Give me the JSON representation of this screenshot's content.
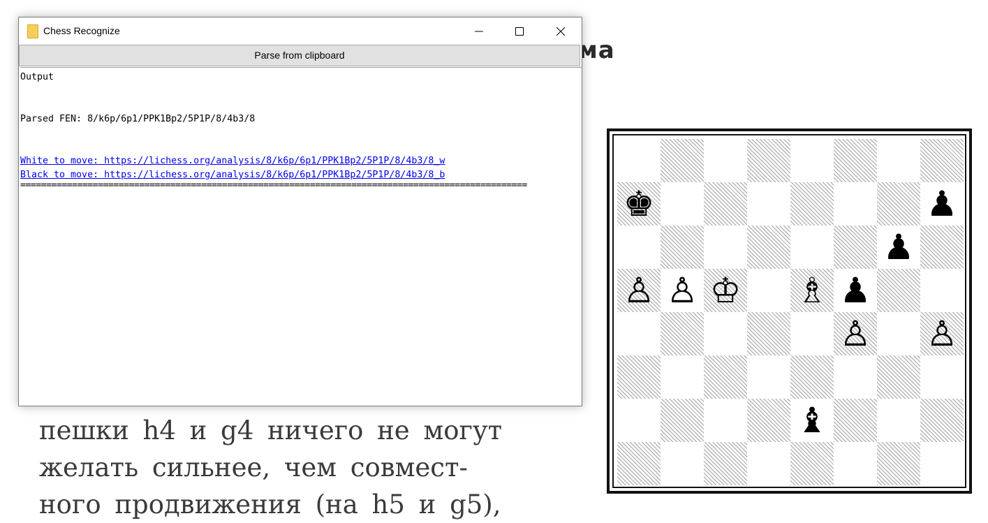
{
  "background": {
    "heading_fragment": "ма",
    "book_lines": [
      "пешки h4 и g4 ничего не могут",
      "желать сильнее, чем совмест-",
      "ного продвижения (на h5 и g5),"
    ]
  },
  "diagram": {
    "pieces": [
      {
        "square": "a7",
        "glyph": "♚",
        "name": "black-king"
      },
      {
        "square": "h7",
        "glyph": "♟",
        "name": "black-pawn"
      },
      {
        "square": "g6",
        "glyph": "♟",
        "name": "black-pawn"
      },
      {
        "square": "a5",
        "glyph": "♙",
        "name": "white-pawn"
      },
      {
        "square": "b5",
        "glyph": "♙",
        "name": "white-pawn"
      },
      {
        "square": "c5",
        "glyph": "♔",
        "name": "white-king"
      },
      {
        "square": "e5",
        "glyph": "♗",
        "name": "white-bishop"
      },
      {
        "square": "f5",
        "glyph": "♟",
        "name": "black-pawn"
      },
      {
        "square": "f4",
        "glyph": "♙",
        "name": "white-pawn"
      },
      {
        "square": "h4",
        "glyph": "♙",
        "name": "white-pawn"
      },
      {
        "square": "e2",
        "glyph": "♝",
        "name": "black-bishop"
      }
    ]
  },
  "window": {
    "title": "Chess Recognize",
    "app_icon": "folder-icon",
    "controls": {
      "minimize": "minimize-icon",
      "maximize": "maximize-icon",
      "close": "close-icon"
    },
    "parse_button_label": "Parse from clipboard",
    "output": {
      "header": "Output",
      "parsed_fen": "Parsed FEN: 8/k6p/6p1/PPK1Bp2/5P1P/8/4b3/8",
      "white_link": "White to move: https://lichess.org/analysis/8/k6p/6p1/PPK1Bp2/5P1P/8/4b3/8_w",
      "black_link": "Black to move: https://lichess.org/analysis/8/k6p/6p1/PPK1Bp2/5P1P/8/4b3/8_b",
      "separator": "=================================================================================================="
    }
  }
}
